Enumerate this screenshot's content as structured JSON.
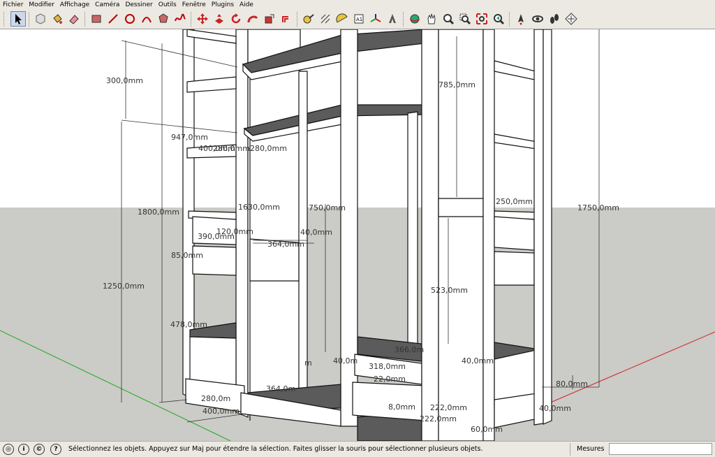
{
  "menu": [
    "Fichier",
    "Modifier",
    "Affichage",
    "Caméra",
    "Dessiner",
    "Outils",
    "Fenêtre",
    "Plugins",
    "Aide"
  ],
  "toolbar": {
    "tools": [
      {
        "name": "select-tool-icon",
        "active": true
      },
      {
        "name": "make-component-icon"
      },
      {
        "name": "paint-bucket-icon"
      },
      {
        "name": "eraser-icon"
      },
      {
        "name": "rectangle-icon"
      },
      {
        "name": "line-icon"
      },
      {
        "name": "circle-icon"
      },
      {
        "name": "arc-icon"
      },
      {
        "name": "polygon-icon"
      },
      {
        "name": "freehand-icon"
      },
      {
        "name": "move-icon"
      },
      {
        "name": "push-pull-icon"
      },
      {
        "name": "rotate-icon"
      },
      {
        "name": "follow-me-icon"
      },
      {
        "name": "scale-icon"
      },
      {
        "name": "offset-icon"
      },
      {
        "name": "tape-measure-icon"
      },
      {
        "name": "dimension-icon"
      },
      {
        "name": "protractor-icon"
      },
      {
        "name": "text-icon"
      },
      {
        "name": "axes-icon"
      },
      {
        "name": "3d-text-icon"
      },
      {
        "name": "orbit-icon"
      },
      {
        "name": "pan-icon"
      },
      {
        "name": "zoom-icon"
      },
      {
        "name": "zoom-window-icon"
      },
      {
        "name": "zoom-extents-icon"
      },
      {
        "name": "previous-view-icon"
      },
      {
        "name": "position-camera-icon"
      },
      {
        "name": "look-around-icon"
      },
      {
        "name": "walk-icon"
      },
      {
        "name": "section-plane-icon"
      }
    ]
  },
  "dimensions": [
    {
      "id": "d1",
      "text": "300,0mm"
    },
    {
      "id": "d2",
      "text": "947,0mm"
    },
    {
      "id": "d3",
      "text": "400,0mm"
    },
    {
      "id": "d4",
      "text": "280,0mm"
    },
    {
      "id": "d5",
      "text": "280,0mm"
    },
    {
      "id": "d6",
      "text": "1800,0mm"
    },
    {
      "id": "d7",
      "text": "1630,0mm"
    },
    {
      "id": "d8",
      "text": "750,0mm"
    },
    {
      "id": "d9",
      "text": "120,0mm"
    },
    {
      "id": "d10",
      "text": "390,0mm"
    },
    {
      "id": "d11",
      "text": "40,0mm"
    },
    {
      "id": "d12",
      "text": "364,0mm"
    },
    {
      "id": "d13",
      "text": "85,0mm"
    },
    {
      "id": "d14",
      "text": "1250,0mm"
    },
    {
      "id": "d15",
      "text": "478,0mm"
    },
    {
      "id": "d16",
      "text": "785,0mm"
    },
    {
      "id": "d17",
      "text": "250,0mm"
    },
    {
      "id": "d18",
      "text": "1750,0mm"
    },
    {
      "id": "d19",
      "text": "523,0mm"
    },
    {
      "id": "d20",
      "text": "366,0m"
    },
    {
      "id": "d21",
      "text": "40,0m"
    },
    {
      "id": "d22",
      "text": "318,0mm"
    },
    {
      "id": "d23",
      "text": "22,0mm"
    },
    {
      "id": "d24",
      "text": "40,0mm"
    },
    {
      "id": "d25",
      "text": "80,0mm"
    },
    {
      "id": "d26",
      "text": "364,0m"
    },
    {
      "id": "d27",
      "text": "280,0m"
    },
    {
      "id": "d28",
      "text": "400,0mm"
    },
    {
      "id": "d29",
      "text": "8,0mm"
    },
    {
      "id": "d30",
      "text": "222,0mm"
    },
    {
      "id": "d31",
      "text": "222,0mm"
    },
    {
      "id": "d32",
      "text": "60,0mm"
    },
    {
      "id": "d33",
      "text": "40,0mm"
    },
    {
      "id": "d34",
      "text": "m"
    }
  ],
  "status": {
    "message": "Sélectionnez les objets. Appuyez sur Maj pour étendre la sélection. Faites glisser la souris pour sélectionner plusieurs objets.",
    "measures_label": "Mesures",
    "measures_value": ""
  },
  "colors": {
    "sky": "#ffffff",
    "ground": "#cbcbc7",
    "shelf_surface": "#5b5b5b",
    "axis_green": "#1faa1f",
    "axis_red": "#d02020"
  }
}
